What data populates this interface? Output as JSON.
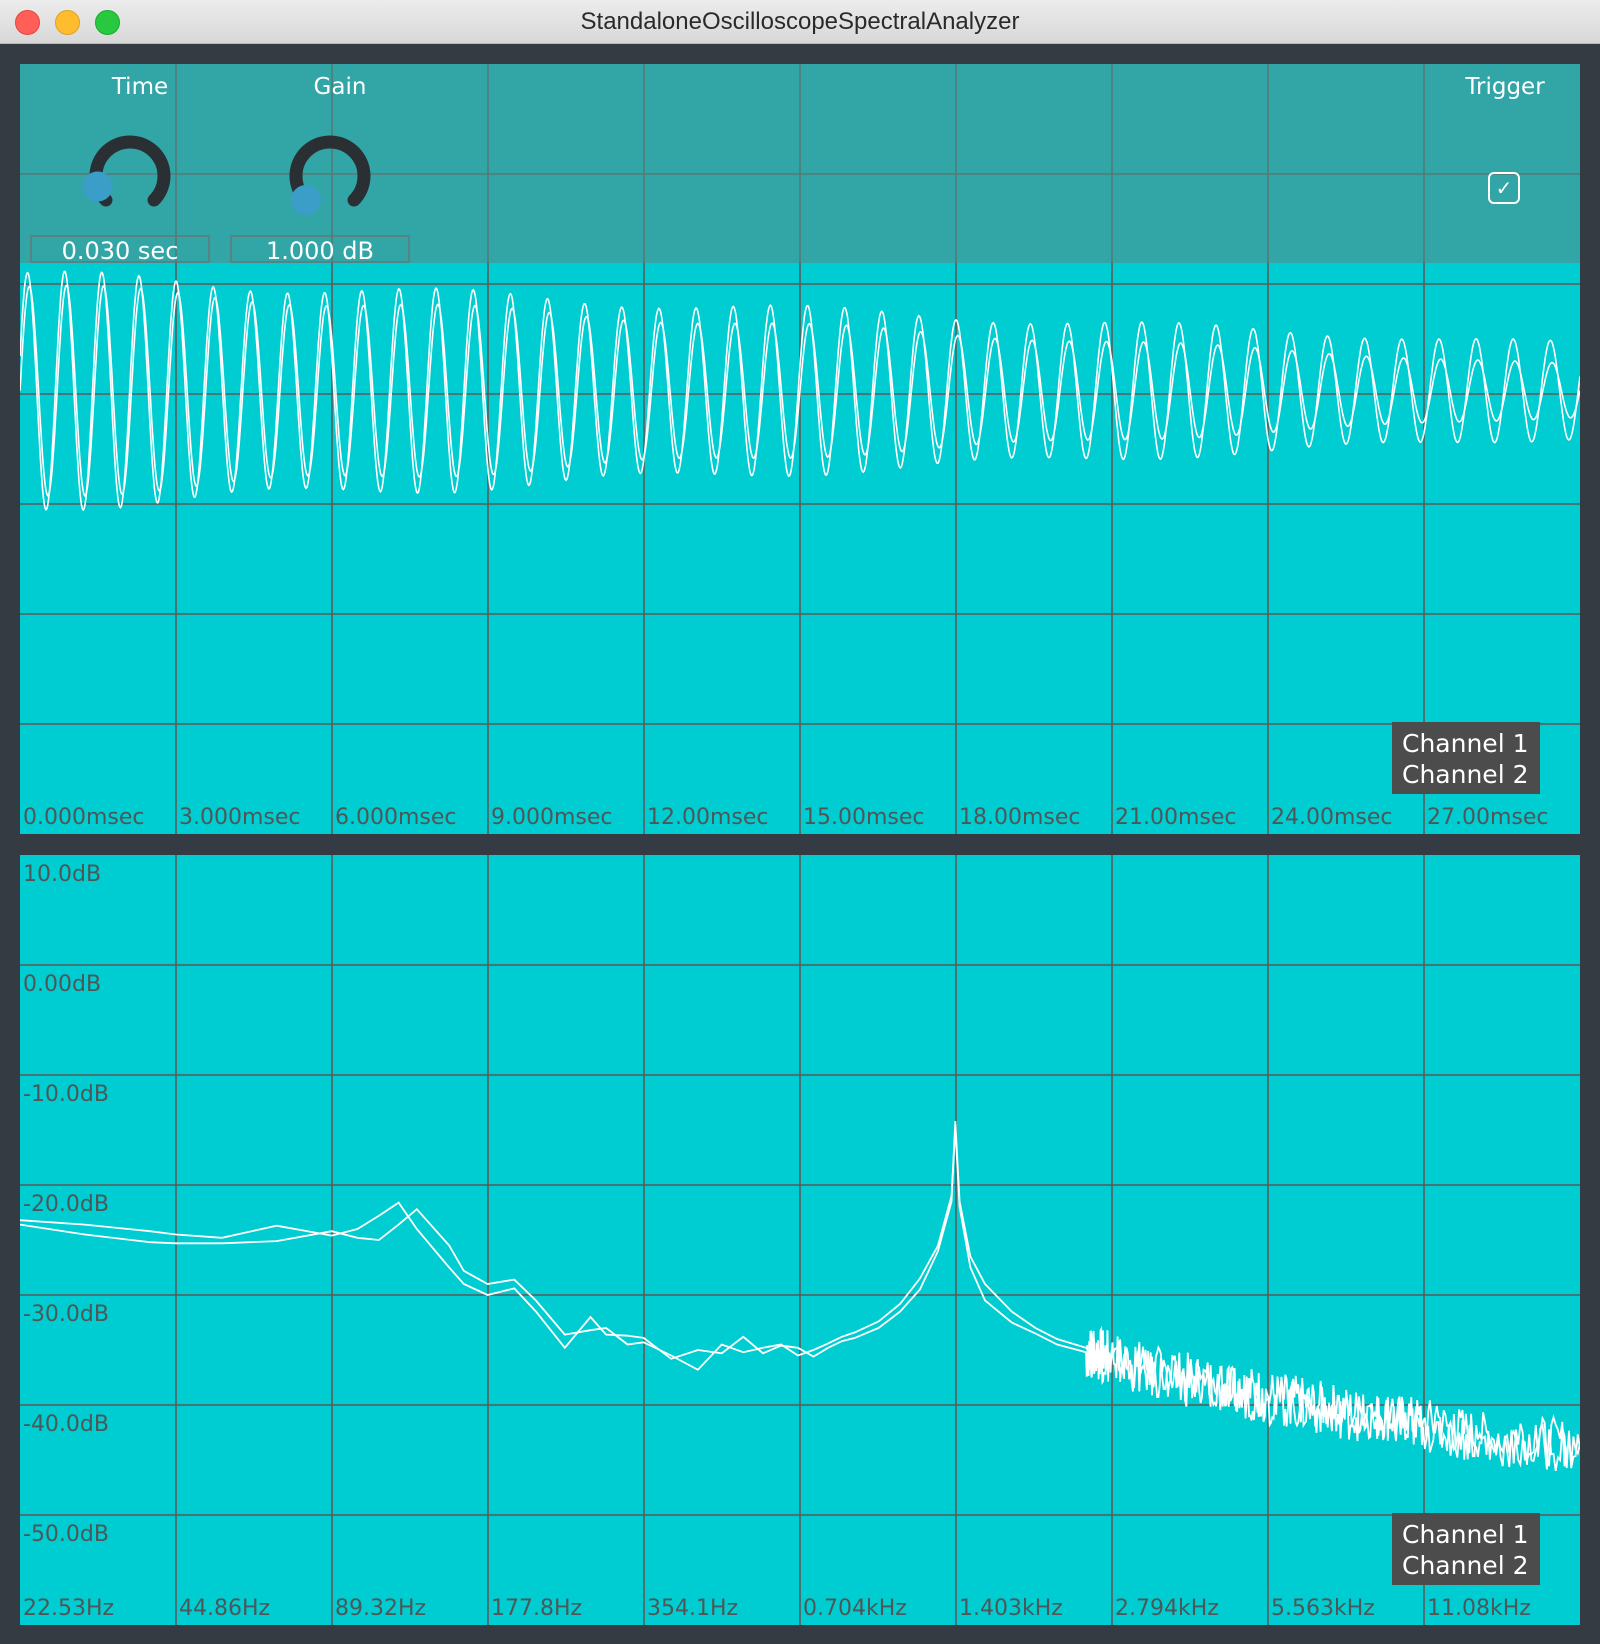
{
  "window": {
    "title": "StandaloneOscilloscopeSpectralAnalyzer"
  },
  "colors": {
    "plot_bg": "#00cdd1",
    "grid": "#5a5a5a",
    "trace": "#ffffff",
    "knob_dot": "#3b9ec9",
    "frame": "#353b43"
  },
  "controls": {
    "time": {
      "label": "Time",
      "value": "0.030 sec",
      "level": 0.1
    },
    "gain": {
      "label": "Gain",
      "value": "1.000 dB",
      "level": 0.0
    },
    "trigger": {
      "label": "Trigger",
      "checked": true
    }
  },
  "oscilloscope": {
    "x_ticks": [
      "0.000msec",
      "3.000msec",
      "6.000msec",
      "9.000msec",
      "12.00msec",
      "15.00msec",
      "18.00msec",
      "21.00msec",
      "24.00msec",
      "27.00msec"
    ],
    "legend": [
      "Channel 1",
      "Channel 2"
    ]
  },
  "spectrum": {
    "y_ticks": [
      "10.0dB",
      "0.00dB",
      "-10.0dB",
      "-20.0dB",
      "-30.0dB",
      "-40.0dB",
      "-50.0dB"
    ],
    "x_ticks": [
      "22.53Hz",
      "44.86Hz",
      "89.32Hz",
      "177.8Hz",
      "354.1Hz",
      "0.704kHz",
      "1.403kHz",
      "2.794kHz",
      "5.563kHz",
      "11.08kHz"
    ],
    "legend": [
      "Channel 1",
      "Channel 2"
    ]
  },
  "chart_data": [
    {
      "type": "line",
      "x_unit": "msec",
      "xlim": [
        0,
        30
      ],
      "signal": {
        "frequency_khz": 1.4,
        "ch1_amplitude_start": 0.9,
        "ch1_amplitude_end": 0.22,
        "ch2_amplitude_start": 1.0,
        "ch2_amplitude_end": 0.4
      },
      "grid": true
    },
    {
      "type": "line",
      "x_scale": "log",
      "xlim_hz": [
        22.53,
        22160
      ],
      "ylim": [
        -55,
        15
      ],
      "grid": true,
      "peak_hz": 1403,
      "series": [
        {
          "name": "Channel 1",
          "x": [
            22.53,
            30,
            40,
            44.86,
            55,
            70,
            89.32,
            100,
            110,
            120,
            130,
            150,
            160,
            177.8,
            200,
            220,
            250,
            280,
            300,
            330,
            354.1,
            400,
            450,
            500,
            550,
            600,
            650,
            700,
            750,
            800,
            850,
            900,
            1000,
            1100,
            1200,
            1300,
            1380,
            1403,
            1430,
            1500,
            1600,
            1800,
            2000,
            2200,
            2500,
            2794,
            3500,
            4500,
            5563,
            7000,
            9000,
            11080,
            15000,
            22160
          ],
          "values": [
            -18.2,
            -18.6,
            -19.2,
            -19.5,
            -19.8,
            -18.7,
            -19.6,
            -19.0,
            -17.8,
            -16.6,
            -19.0,
            -22.5,
            -24.0,
            -25.0,
            -24.4,
            -26.5,
            -29.8,
            -27.0,
            -28.6,
            -28.7,
            -28.9,
            -30.8,
            -30.0,
            -30.3,
            -28.8,
            -30.3,
            -29.6,
            -29.8,
            -30.6,
            -29.8,
            -29.2,
            -28.9,
            -28.0,
            -26.5,
            -24.5,
            -21.0,
            -16.5,
            -9.2,
            -16.5,
            -21.5,
            -24.0,
            -26.5,
            -28.0,
            -29.0,
            -29.8,
            -30.5,
            -32.0,
            -33.0,
            -34.0,
            -35.0,
            -36.0,
            -36.5,
            -38.0,
            -38.5
          ]
        },
        {
          "name": "Channel 2",
          "x": [
            22.53,
            30,
            40,
            44.86,
            55,
            70,
            89.32,
            100,
            110,
            120,
            130,
            150,
            160,
            177.8,
            200,
            220,
            250,
            280,
            300,
            330,
            354.1,
            400,
            450,
            500,
            550,
            600,
            650,
            700,
            750,
            800,
            850,
            900,
            1000,
            1100,
            1200,
            1300,
            1380,
            1403,
            1430,
            1500,
            1600,
            1800,
            2000,
            2200,
            2500,
            2794,
            3500,
            4500,
            5563,
            7000,
            9000,
            11080,
            15000,
            22160
          ],
          "values": [
            -18.6,
            -19.5,
            -20.2,
            -20.3,
            -20.3,
            -20.1,
            -19.2,
            -19.8,
            -20.0,
            -18.6,
            -17.2,
            -20.5,
            -22.8,
            -24.0,
            -23.6,
            -25.5,
            -28.6,
            -28.2,
            -28.0,
            -29.5,
            -29.3,
            -30.5,
            -31.8,
            -29.5,
            -30.2,
            -29.8,
            -29.5,
            -30.5,
            -30.0,
            -29.4,
            -28.8,
            -28.4,
            -27.4,
            -25.8,
            -23.5,
            -20.5,
            -16.0,
            -9.8,
            -17.0,
            -22.5,
            -25.5,
            -27.5,
            -28.5,
            -29.5,
            -30.2,
            -31.0,
            -32.5,
            -33.5,
            -34.5,
            -35.5,
            -36.3,
            -37.0,
            -38.5,
            -39.0
          ]
        }
      ]
    }
  ]
}
